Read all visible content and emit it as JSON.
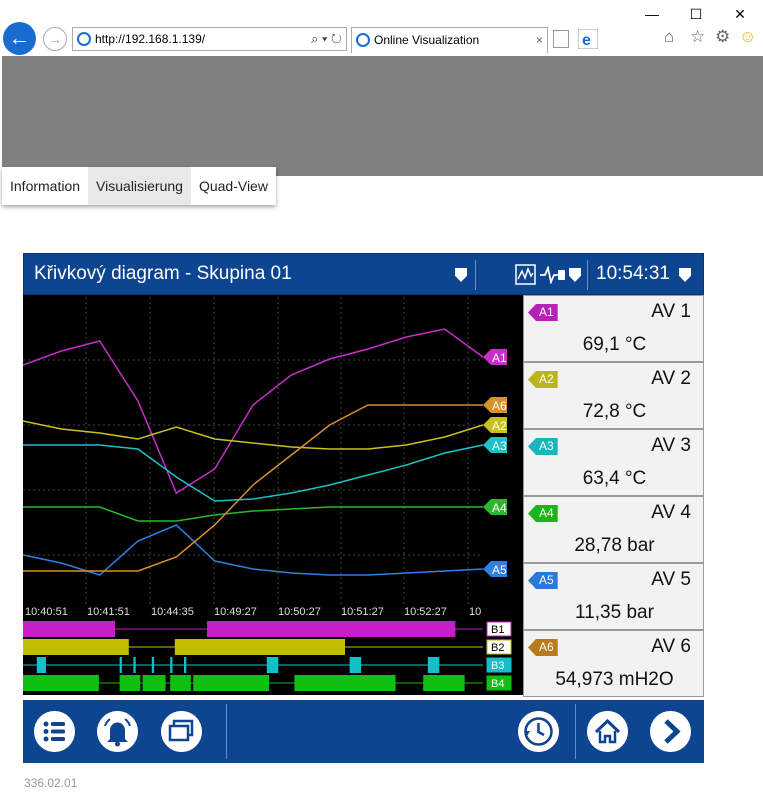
{
  "browser": {
    "url": "http://192.168.1.139/",
    "tab_title": "Online Visualization",
    "tab_close": "×",
    "minimize": "—",
    "maximize": "☐",
    "close": "✕"
  },
  "menu": {
    "items": [
      {
        "label": "Information"
      },
      {
        "label": "Visualisierung"
      },
      {
        "label": "Quad-View"
      }
    ],
    "active_index": 1
  },
  "panel": {
    "title": "Křivkový diagram - Skupina 01",
    "time": "10:54:31"
  },
  "chart_data": {
    "type": "line",
    "x": [
      "10:40:51",
      "10:41:51",
      "10:44:35",
      "10:49:27",
      "10:50:27",
      "10:51:27",
      "10:52:27",
      "10"
    ],
    "series": [
      {
        "name": "A1",
        "color": "#c72fc7",
        "values": [
          100,
          107,
          112,
          82,
          36,
          48,
          80,
          95,
          103,
          108,
          114,
          118,
          104
        ]
      },
      {
        "name": "A2",
        "color": "#c8c21f",
        "values": [
          72,
          68,
          66,
          63,
          69,
          63,
          61,
          59,
          58,
          58,
          60,
          64,
          70
        ]
      },
      {
        "name": "A3",
        "color": "#1fc0c8",
        "values": [
          60,
          60,
          60,
          58,
          44,
          32,
          33,
          36,
          40,
          45,
          50,
          56,
          60
        ]
      },
      {
        "name": "A4",
        "color": "#2db72d",
        "values": [
          29,
          29,
          29,
          22,
          22,
          25,
          27,
          28,
          29,
          29,
          29,
          29,
          29
        ]
      },
      {
        "name": "A5",
        "color": "#2f7fe0",
        "values": [
          5,
          1,
          -5,
          12,
          20,
          2,
          -2,
          -4,
          -5,
          -5,
          -4,
          -3,
          -2
        ]
      },
      {
        "name": "A6",
        "color": "#d8902a",
        "values": [
          -3,
          -3,
          -3,
          -3,
          4,
          20,
          40,
          55,
          70,
          80,
          80,
          80,
          80
        ]
      }
    ],
    "binary_channels": [
      {
        "name": "B1",
        "color": "#c71fc7",
        "on": [
          [
            0,
            0.2
          ],
          [
            0.4,
            0.94
          ]
        ]
      },
      {
        "name": "B2",
        "color": "#bfbf00",
        "on": [
          [
            0,
            0.23
          ],
          [
            0.33,
            0.7
          ]
        ]
      },
      {
        "name": "B3",
        "color": "#14c0c8",
        "on": [
          [
            0.03,
            0.05
          ],
          [
            0.21,
            0.215
          ],
          [
            0.24,
            0.245
          ],
          [
            0.28,
            0.285
          ],
          [
            0.32,
            0.325
          ],
          [
            0.35,
            0.355
          ],
          [
            0.53,
            0.555
          ],
          [
            0.71,
            0.735
          ],
          [
            0.88,
            0.905
          ]
        ]
      },
      {
        "name": "B4",
        "color": "#10c010",
        "on": [
          [
            0,
            0.165
          ],
          [
            0.21,
            0.255
          ],
          [
            0.26,
            0.31
          ],
          [
            0.32,
            0.365
          ],
          [
            0.37,
            0.535
          ],
          [
            0.59,
            0.81
          ],
          [
            0.87,
            0.96
          ]
        ]
      }
    ]
  },
  "channels": [
    {
      "tag": "A1",
      "name": "AV 1",
      "value": "69,1 °C",
      "color": "#b621b6"
    },
    {
      "tag": "A2",
      "name": "AV 2",
      "value": "72,8 °C",
      "color": "#bbb51a"
    },
    {
      "tag": "A3",
      "name": "AV 3",
      "value": "63,4 °C",
      "color": "#19b5bd"
    },
    {
      "tag": "A4",
      "name": "AV 4",
      "value": "28,78 bar",
      "color": "#19b519"
    },
    {
      "tag": "A5",
      "name": "AV 5",
      "value": "11,35 bar",
      "color": "#2a78d8"
    },
    {
      "tag": "A6",
      "name": "AV 6",
      "value": "54,973 mH2O",
      "color": "#b87a1a"
    }
  ],
  "footer": {
    "version": "336.02.01"
  },
  "icons": [
    "back-icon",
    "forward-icon",
    "ie-icon",
    "search-icon",
    "refresh-icon",
    "home-icon",
    "star-icon",
    "gear-icon",
    "smiley-icon",
    "list-icon",
    "bell-icon",
    "windows-icon",
    "history-icon",
    "home-button-icon",
    "next-icon"
  ]
}
